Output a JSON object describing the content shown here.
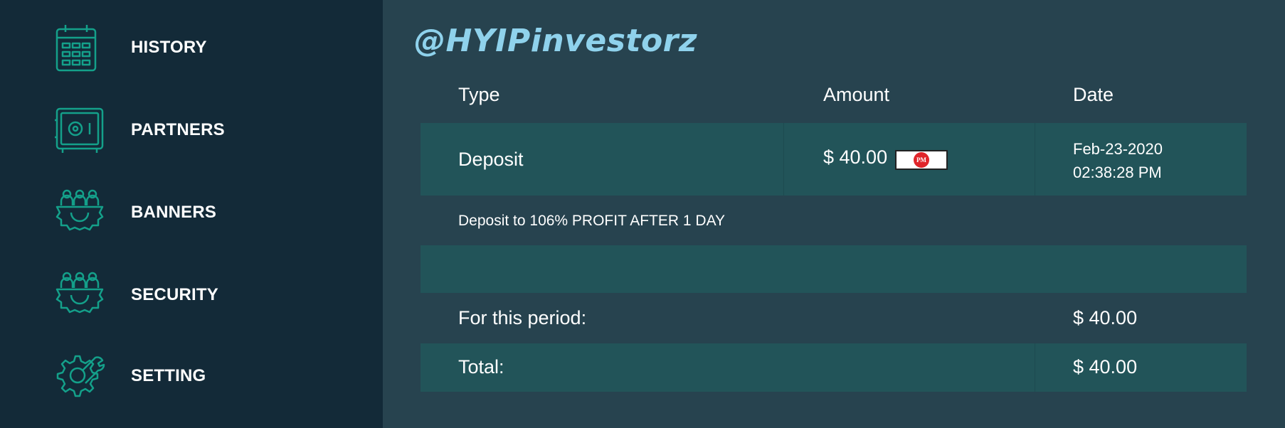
{
  "sidebar": {
    "items": [
      {
        "label": "HISTORY",
        "icon": "calendar-icon"
      },
      {
        "label": "PARTNERS",
        "icon": "safe-icon"
      },
      {
        "label": "BANNERS",
        "icon": "team-gear-icon"
      },
      {
        "label": "SECURITY",
        "icon": "team-gear-icon"
      },
      {
        "label": "SETTING",
        "icon": "wrench-gear-icon"
      }
    ]
  },
  "watermark": "@HYIPinvestorz",
  "table": {
    "headers": {
      "type": "Type",
      "amount": "Amount",
      "date": "Date"
    },
    "row": {
      "type": "Deposit",
      "amount": "$ 40.00",
      "processor_badge": "PM",
      "date": "Feb-23-2020",
      "time": "02:38:28 PM",
      "description": "Deposit to 106% PROFIT AFTER 1 DAY"
    },
    "period_label": "For this period:",
    "period_value": "$ 40.00",
    "total_label": "Total:",
    "total_value": "$ 40.00"
  },
  "colors": {
    "sidebar_bg": "#132a38",
    "main_bg": "#27434f",
    "row_teal": "#225459",
    "icon_teal": "#14a08a",
    "watermark": "#8fd2ec"
  }
}
